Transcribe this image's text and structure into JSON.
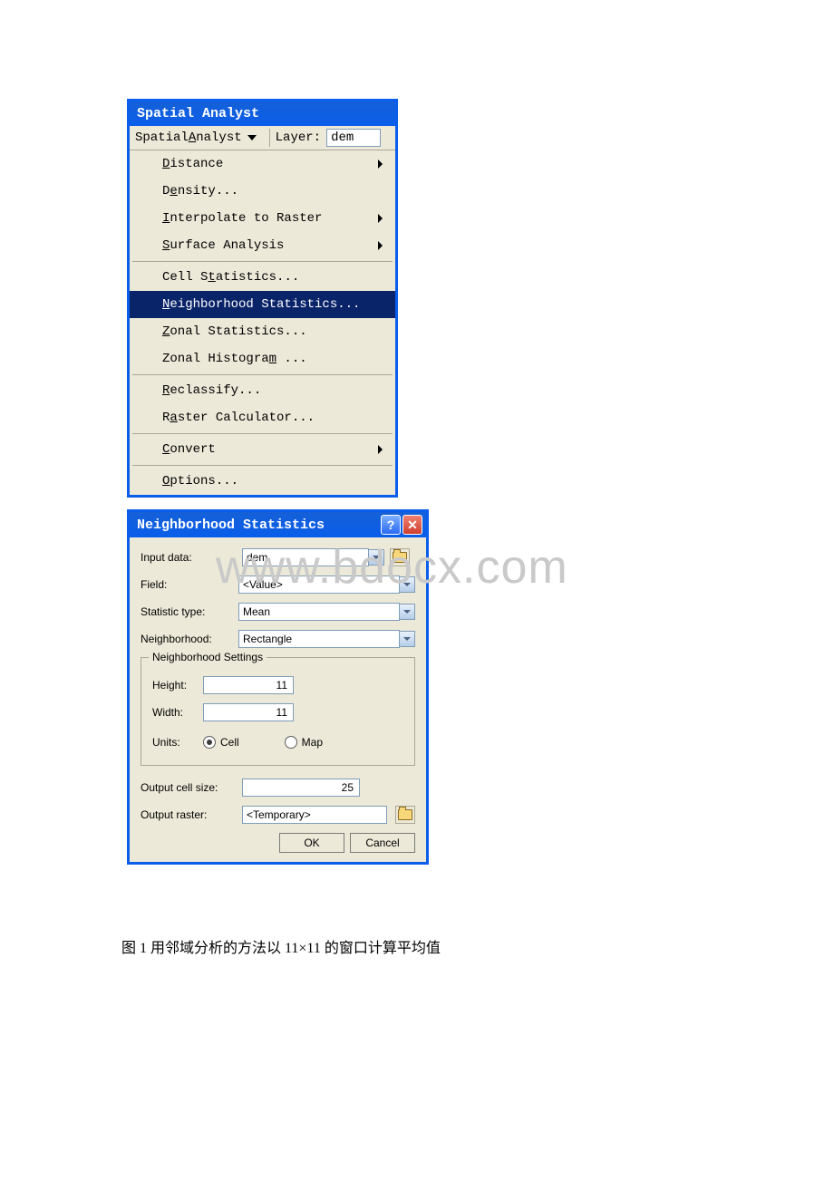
{
  "toolbar": {
    "title": "Spatial Analyst",
    "menu_button": {
      "prefix": "Spatial ",
      "u": "A",
      "suffix": "nalyst"
    },
    "layer_label": "Layer:",
    "layer_value": "dem"
  },
  "menu": {
    "items": [
      {
        "prefix": "",
        "u": "D",
        "suffix": "istance",
        "arrow": true
      },
      {
        "prefix": "D",
        "u": "e",
        "suffix": "nsity...",
        "arrow": false
      },
      {
        "prefix": "",
        "u": "I",
        "suffix": "nterpolate to Raster",
        "arrow": true
      },
      {
        "prefix": "",
        "u": "S",
        "suffix": "urface Analysis",
        "arrow": true
      },
      {
        "divider": true
      },
      {
        "prefix": "Cell S",
        "u": "t",
        "suffix": "atistics...",
        "arrow": false
      },
      {
        "prefix": "",
        "u": "N",
        "suffix": "eighborhood Statistics...",
        "arrow": false,
        "highlighted": true
      },
      {
        "prefix": "",
        "u": "Z",
        "suffix": "onal Statistics...",
        "arrow": false
      },
      {
        "prefix": "Zonal Histogra",
        "u": "m",
        "suffix": " ...",
        "arrow": false
      },
      {
        "divider": true
      },
      {
        "prefix": "",
        "u": "R",
        "suffix": "eclassify...",
        "arrow": false
      },
      {
        "prefix": "R",
        "u": "a",
        "suffix": "ster Calculator...",
        "arrow": false
      },
      {
        "divider": true
      },
      {
        "prefix": "",
        "u": "C",
        "suffix": "onvert",
        "arrow": true
      },
      {
        "divider": true
      },
      {
        "prefix": "",
        "u": "O",
        "suffix": "ptions...",
        "arrow": false
      }
    ]
  },
  "dialog": {
    "title": "Neighborhood Statistics",
    "input_data_label": "Input data:",
    "input_data_value": "dem",
    "field_label": "Field:",
    "field_value": "<Value>",
    "stat_type_label": "Statistic type:",
    "stat_type_value": "Mean",
    "neighborhood_label": "Neighborhood:",
    "neighborhood_value": "Rectangle",
    "settings_legend": "Neighborhood Settings",
    "height_label": "Height:",
    "height_value": "11",
    "width_label": "Width:",
    "width_value": "11",
    "units_label": "Units:",
    "unit_cell": "Cell",
    "unit_map": "Map",
    "output_cell_label": "Output cell size:",
    "output_cell_value": "25",
    "output_raster_label": "Output raster:",
    "output_raster_value": "<Temporary>",
    "ok": "OK",
    "cancel": "Cancel"
  },
  "watermark": "www.bdocx.com",
  "caption": "图 1 用邻域分析的方法以 11×11 的窗口计算平均值"
}
